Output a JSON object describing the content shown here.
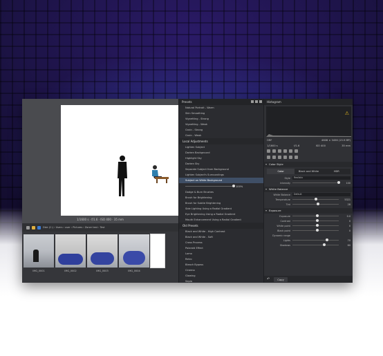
{
  "presets_panel": {
    "title": "Presets",
    "items_top": [
      "Natural Portrait - Warm",
      "Skin Smoothing",
      "Vignetting - Strong",
      "Vignetting - Weak",
      "Grain - Strong",
      "Grain - Weak"
    ],
    "group_local": "Local Adjustments",
    "items_local": [
      "Lighten Subject",
      "Darken Background",
      "Highlight Sky",
      "Darken Sky",
      "Separate Subject from Background",
      "Lighten Subject's Surroundings",
      "Subject on White Background"
    ],
    "amount_value": "100%",
    "items_local_2": [
      "Dodge & Burn Brushes",
      "Brush for Brightening",
      "Brush for Subtle Brightening",
      "Side Lighting Using a Radial Gradient",
      "Eye Brightening Using a Radial Gradient",
      "Mouth Enhancement Using a Radial Gradient"
    ],
    "group_old": "Old Presets",
    "items_old": [
      "Black and White - High Contrast",
      "Black and White - Soft",
      "Cross Process",
      "Polaroid Effect",
      "Lomo",
      "Retro",
      "Bleach Bypass",
      "Cinema",
      "Glowing",
      "Sepia"
    ]
  },
  "viewer": {
    "status": "1/1600 s · f/1.6 · ISO 400 · 35 mm"
  },
  "filmstrip": {
    "breadcrumb": "Disk (C:) › Users › user › Pictures › Zoner test › Test",
    "thumbs": [
      "IMG_0001",
      "IMG_0002",
      "IMG_0003",
      "IMG_0004"
    ]
  },
  "tools_panel": {
    "histogram_title": "Histogram",
    "exif_left": "1/1600 s",
    "exif_mid": "f/1.6",
    "exif_iso": "ISO 400",
    "exif_focal": "35 mm",
    "exif_file": "ORF",
    "exif_size": "4608 × 3456 (15.9 MP)",
    "color_style": {
      "title": "Color Style",
      "tabs": [
        "Color",
        "Black and White",
        "HDR"
      ],
      "style_label": "Style",
      "style_value": "Realistic",
      "intensity_label": "Intensity",
      "intensity_value": "100"
    },
    "white_balance": {
      "title": "White Balance",
      "wb_label": "White Balance",
      "wb_value": "Default",
      "temp_label": "Temperature",
      "temp_value": "5321",
      "tint_label": "Tint",
      "tint_value": "28"
    },
    "exposure": {
      "title": "Exposure",
      "rows": [
        {
          "label": "Exposure",
          "value": "0.0",
          "pos": 0.5
        },
        {
          "label": "Contrast",
          "value": "0",
          "pos": 0.5
        },
        {
          "label": "White point",
          "value": "0",
          "pos": 0.5
        },
        {
          "label": "Black point",
          "value": "0",
          "pos": 0.5
        },
        {
          "label": "Dynamic range",
          "value": "",
          "pos": -1
        },
        {
          "label": "Lights",
          "value": "70",
          "pos": 0.72
        },
        {
          "label": "Shadows",
          "value": "60",
          "pos": 0.66
        }
      ]
    },
    "copy_label": "Copy"
  }
}
